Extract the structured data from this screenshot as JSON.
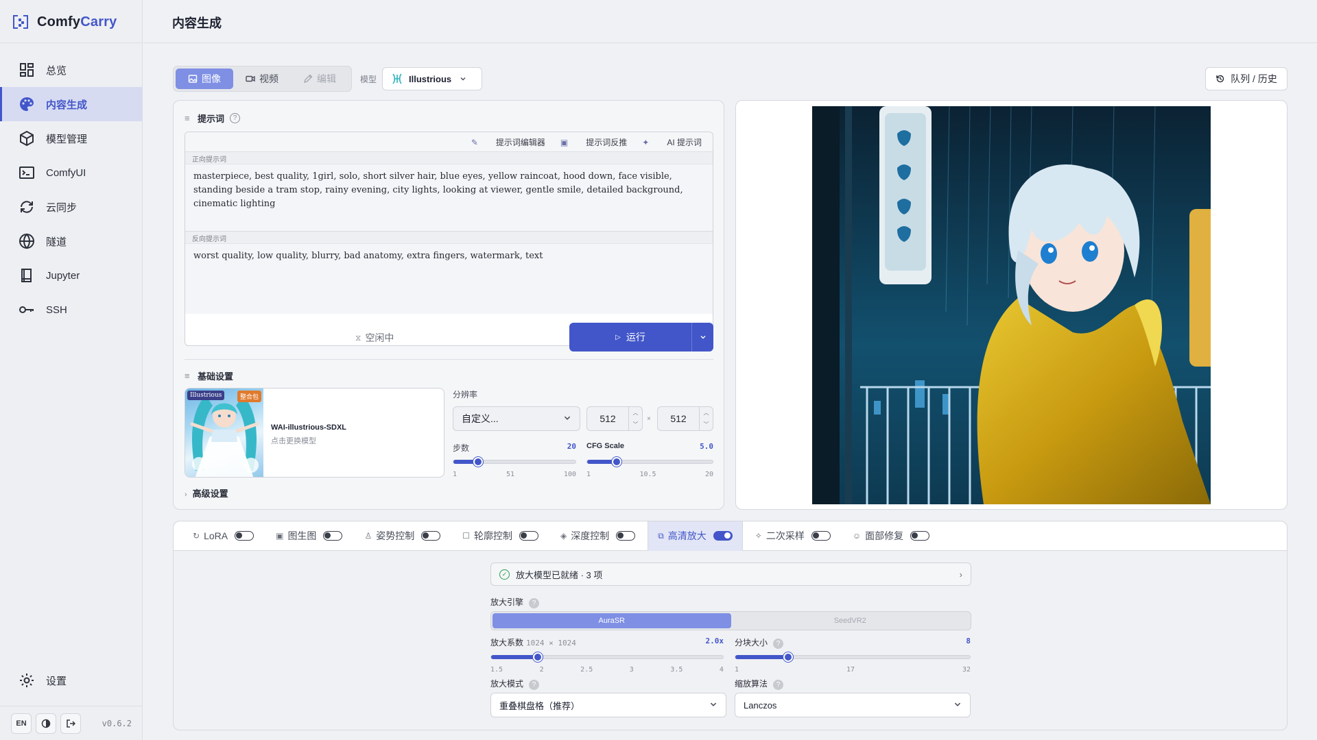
{
  "app": {
    "name_part1": "Comfy",
    "name_part2": "Carry",
    "version": "v0.6.2"
  },
  "sidebar": {
    "items": [
      {
        "label": "总览",
        "icon": "dashboard-icon"
      },
      {
        "label": "内容生成",
        "icon": "palette-icon",
        "active": true
      },
      {
        "label": "模型管理",
        "icon": "cube-icon"
      },
      {
        "label": "ComfyUI",
        "icon": "terminal-icon"
      },
      {
        "label": "云同步",
        "icon": "cloud-sync-icon"
      },
      {
        "label": "隧道",
        "icon": "globe-icon"
      },
      {
        "label": "Jupyter",
        "icon": "notebook-icon"
      },
      {
        "label": "SSH",
        "icon": "key-icon"
      }
    ],
    "settings_label": "设置",
    "lang_label": "EN"
  },
  "header": {
    "title": "内容生成"
  },
  "mode_tabs": {
    "image": "图像",
    "video": "视频",
    "edit": "编辑"
  },
  "model_picker": {
    "label": "模型",
    "value": "Illustrious"
  },
  "queue_button": "队列 / 历史",
  "prompt": {
    "section_title": "提示词",
    "tools": {
      "editor": "提示词编辑器",
      "reverse": "提示词反推",
      "ai": "AI 提示词"
    },
    "positive_label": "正向提示词",
    "positive_text": "masterpiece, best quality, 1girl, solo, short silver hair, blue eyes, yellow raincoat, hood down, face visible, standing beside a tram stop, rainy evening, city lights, looking at viewer, gentle smile, detailed background, cinematic lighting",
    "negative_label": "反向提示词",
    "negative_text": "worst quality, low quality, blurry, bad anatomy, extra fingers, watermark, text"
  },
  "run": {
    "status": "空闲中",
    "button": "运行"
  },
  "basic": {
    "section_title": "基础设置",
    "model_card": {
      "name": "WAI-illustrious-SDXL",
      "sub": "点击更换模型",
      "badge_left": "Illustrious",
      "badge_right": "整合包"
    },
    "resolution": {
      "label": "分辨率",
      "preset": "自定义...",
      "width": "512",
      "height": "512",
      "times": "×"
    },
    "steps": {
      "label": "步数",
      "value": "20",
      "fraction": 0.2,
      "ticks": [
        "1",
        "51",
        "100"
      ]
    },
    "cfg": {
      "label": "CFG Scale",
      "value": "5.0",
      "fraction": 0.237,
      "ticks": [
        "1",
        "10.5",
        "20"
      ]
    },
    "advanced": "高级设置"
  },
  "features": {
    "tabs": [
      {
        "label": "LoRA",
        "icon": "refresh-icon",
        "on": false
      },
      {
        "label": "图生图",
        "icon": "image-icon",
        "on": false
      },
      {
        "label": "姿势控制",
        "icon": "person-icon",
        "on": false
      },
      {
        "label": "轮廓控制",
        "icon": "outline-icon",
        "on": false
      },
      {
        "label": "深度控制",
        "icon": "layers-icon",
        "on": false
      },
      {
        "label": "高清放大",
        "icon": "upscale-icon",
        "on": true
      },
      {
        "label": "二次采样",
        "icon": "sparkle-icon",
        "on": false
      },
      {
        "label": "面部修复",
        "icon": "face-icon",
        "on": false
      }
    ]
  },
  "upscale": {
    "status": "放大模型已就绪 · 3 项",
    "engine_label": "放大引擎",
    "engines": [
      "AuraSR",
      "SeedVR2"
    ],
    "factor": {
      "label": "放大系数",
      "dims": "1024 × 1024",
      "value": "2.0x",
      "fraction": 0.2,
      "ticks": [
        "1.5",
        "2",
        "2.5",
        "3",
        "3.5",
        "4"
      ]
    },
    "tile": {
      "label": "分块大小",
      "value": "8",
      "fraction": 0.226,
      "ticks": [
        "1",
        "17",
        "32"
      ]
    },
    "mode": {
      "label": "放大模式",
      "value": "重叠棋盘格（推荐）"
    },
    "algo": {
      "label": "缩放算法",
      "value": "Lanczos"
    }
  },
  "colors": {
    "accent": "#4256c9",
    "accent_light": "#7e8fe4",
    "success": "#2b9d4d"
  }
}
